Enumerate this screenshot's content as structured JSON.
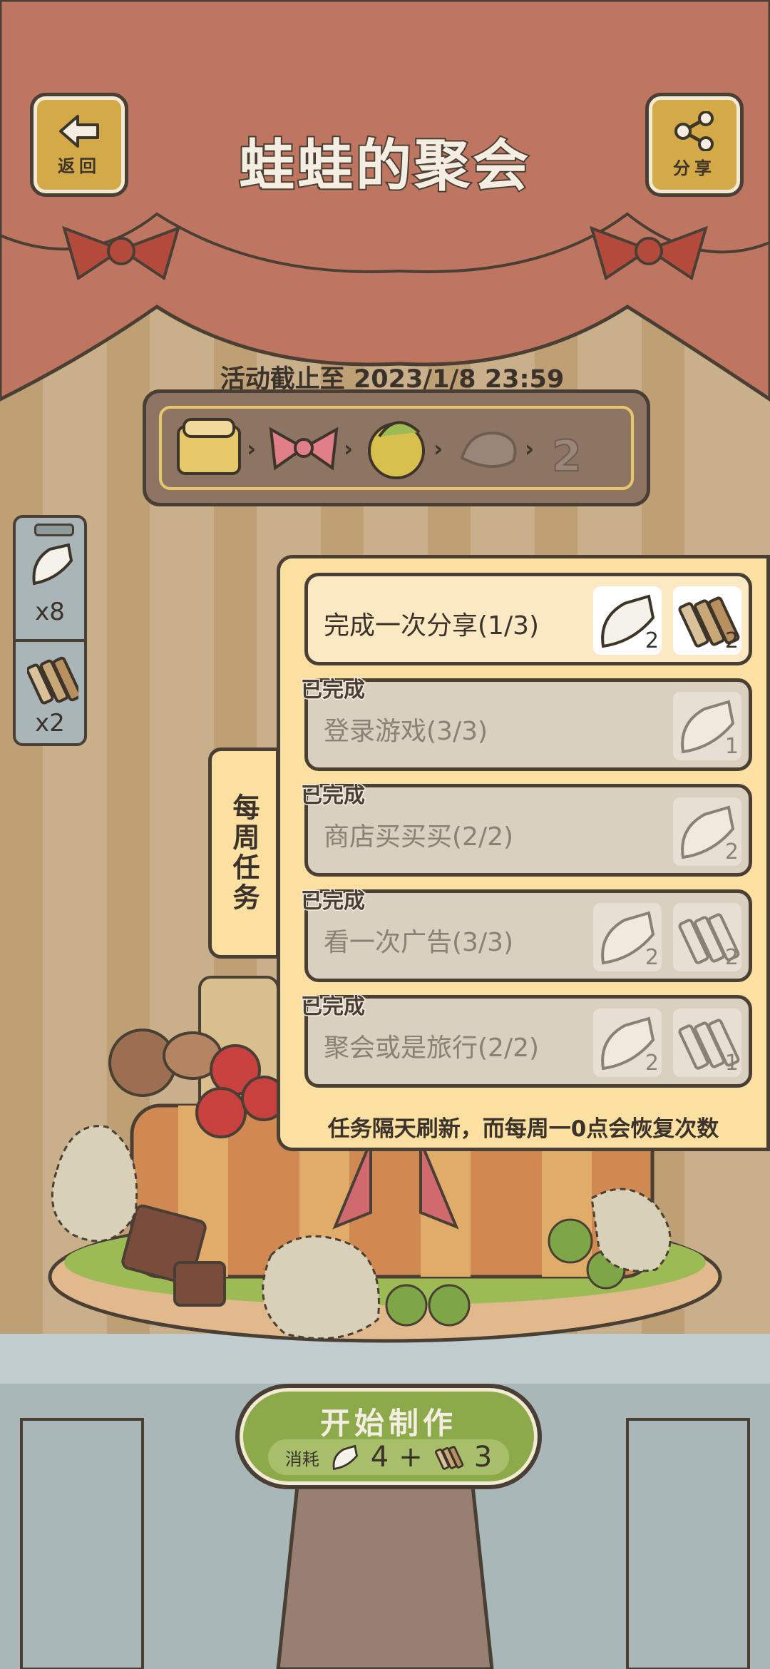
{
  "header": {
    "title": "蛙蛙的聚会",
    "back_label": "返回",
    "share_label": "分享"
  },
  "event": {
    "deadline": "活动截止至 2023/1/8 23:59",
    "stages": [
      "cake-base-icon",
      "bow-icon",
      "shell-house-icon",
      "leaf-creature-icon",
      "number-two-icon"
    ]
  },
  "inventory": [
    {
      "icon": "piping-bag-icon",
      "count": "x8"
    },
    {
      "icon": "crayons-icon",
      "count": "x2"
    }
  ],
  "tasks_tab": {
    "label": "每周任务"
  },
  "tasks": [
    {
      "name": "完成一次分享(1/3)",
      "done": false,
      "rewards": [
        {
          "icon": "piping-bag-icon",
          "qty": "2"
        },
        {
          "icon": "crayons-icon",
          "qty": "2"
        }
      ]
    },
    {
      "name": "登录游戏(3/3)",
      "done": true,
      "done_label": "已完成",
      "rewards": [
        {
          "icon": "piping-bag-icon",
          "qty": "1"
        }
      ]
    },
    {
      "name": "商店买买买(2/2)",
      "done": true,
      "done_label": "已完成",
      "rewards": [
        {
          "icon": "piping-bag-icon",
          "qty": "2"
        }
      ]
    },
    {
      "name": "看一次广告(3/3)",
      "done": true,
      "done_label": "已完成",
      "rewards": [
        {
          "icon": "piping-bag-icon",
          "qty": "2"
        },
        {
          "icon": "crayons-icon",
          "qty": "2"
        }
      ]
    },
    {
      "name": "聚会或是旅行(2/2)",
      "done": true,
      "done_label": "已完成",
      "rewards": [
        {
          "icon": "piping-bag-icon",
          "qty": "2"
        },
        {
          "icon": "crayons-icon",
          "qty": "1"
        }
      ]
    }
  ],
  "tasks_note": "任务隔天刷新，而每周一0点会恢复次数",
  "start_button": {
    "label": "开始制作",
    "cost_label": "消耗",
    "cost_bag": "4",
    "cost_plus": "+",
    "cost_crayon": "3"
  }
}
